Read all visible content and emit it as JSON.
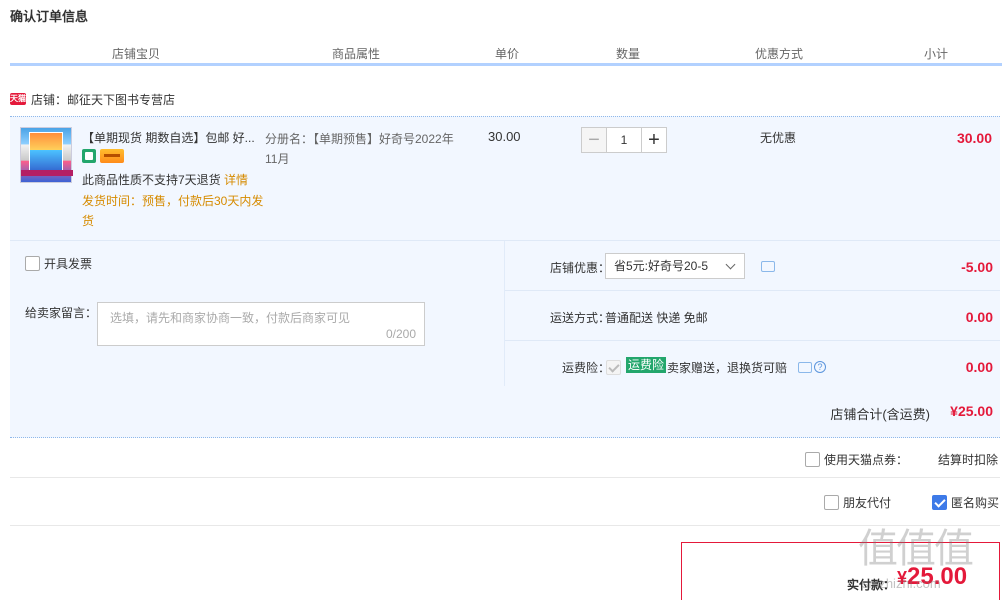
{
  "page": {
    "title": "确认订单信息"
  },
  "columns": [
    "店铺宝贝",
    "商品属性",
    "单价",
    "数量",
    "优惠方式",
    "小计"
  ],
  "shop": {
    "badge": "天猫",
    "label": "店铺：邮征天下图书专营店"
  },
  "item": {
    "title": "【单期现货 期数自选】包邮 好...",
    "policy_text": "此商品性质不支持7天退货",
    "policy_link": "详情",
    "ship_time": "发货时间：预售，付款后30天内发货",
    "attr": "分册名：【单期预售】好奇号2022年11月",
    "price": "30.00",
    "quantity": "1",
    "minus": "−",
    "plus": "+",
    "discount": "无优惠",
    "subtotal": "30.00",
    "icons": [
      "green-badge-icon",
      "card-icon"
    ]
  },
  "options": {
    "invoice_label": "开具发票",
    "message_label": "给卖家留言：",
    "message_placeholder": "选填，请先和商家协商一致，付款后商家可见",
    "message_count": "0/200",
    "shop_discount_label": "店铺优惠：",
    "shop_discount_value": "省5元:好奇号20-5",
    "shop_discount_amount": "-5.00",
    "shipping_label": "运送方式：",
    "shipping_value": "普通配送 快递 免邮",
    "shipping_amount": "0.00",
    "insurance_label": "运费险：",
    "insurance_tag": "运费险",
    "insurance_text": "卖家赠送，退换货可赔",
    "insurance_amount": "0.00"
  },
  "shop_total": {
    "label": "店铺合计(含运费)",
    "value": "¥25.00"
  },
  "coupon": {
    "label": "使用天猫点券：",
    "note": "结算时扣除"
  },
  "payment": {
    "friend_label": "朋友代付",
    "anon_label": "匿名购买",
    "anon_checked": true
  },
  "final": {
    "label": "实付款：",
    "currency": "¥",
    "amount": "25.00"
  },
  "watermark": {
    "chars": "值值值",
    "url": "smzhizhi.com"
  },
  "colors": {
    "accent": "#e4193a",
    "border_blue": "#b2d1ff",
    "bg_blue": "#f2f7ff",
    "orange": "#d68b00",
    "green": "#23a66c"
  }
}
